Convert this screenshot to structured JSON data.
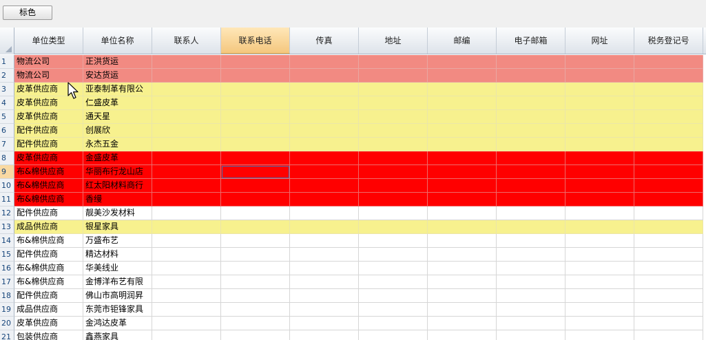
{
  "toolbar": {
    "button_label": "标色"
  },
  "columns": [
    "单位类型",
    "单位名称",
    "联系人",
    "联系电话",
    "传真",
    "地址",
    "邮编",
    "电子邮箱",
    "网址",
    "税务登记号"
  ],
  "selected_column": 3,
  "active_cell": {
    "row": 9,
    "col": 3
  },
  "colors": {
    "salmon": "#f28a82",
    "yellow": "#f7f18e",
    "red": "#ff0000",
    "white": "#ffffff"
  },
  "rows": [
    {
      "n": "1",
      "type": "物流公司",
      "name": "正洪货运",
      "color": "salmon"
    },
    {
      "n": "2",
      "type": "物流公司",
      "name": "安达货运",
      "color": "salmon"
    },
    {
      "n": "3",
      "type": "皮革供应商",
      "name": "亚泰制革有限公",
      "color": "yellow"
    },
    {
      "n": "4",
      "type": "皮革供应商",
      "name": "仁盛皮革",
      "color": "yellow"
    },
    {
      "n": "5",
      "type": "皮革供应商",
      "name": "通天星",
      "color": "yellow"
    },
    {
      "n": "6",
      "type": "配件供应商",
      "name": "创展欣",
      "color": "yellow"
    },
    {
      "n": "7",
      "type": "配件供应商",
      "name": "永杰五金",
      "color": "yellow"
    },
    {
      "n": "8",
      "type": "皮革供应商",
      "name": "金盛皮革",
      "color": "red"
    },
    {
      "n": "9",
      "type": "布&棉供应商",
      "name": "华丽布行龙山店",
      "color": "red"
    },
    {
      "n": "10",
      "type": "布&棉供应商",
      "name": "红太阳材料商行",
      "color": "red"
    },
    {
      "n": "11",
      "type": "布&棉供应商",
      "name": "香缦",
      "color": "red"
    },
    {
      "n": "12",
      "type": "配件供应商",
      "name": "靓美沙发材料",
      "color": "white"
    },
    {
      "n": "13",
      "type": "成品供应商",
      "name": "银星家具",
      "color": "yellow"
    },
    {
      "n": "14",
      "type": "布&棉供应商",
      "name": "万盛布艺",
      "color": "white"
    },
    {
      "n": "15",
      "type": "配件供应商",
      "name": "精达材料",
      "color": "white"
    },
    {
      "n": "16",
      "type": "布&棉供应商",
      "name": "华美线业",
      "color": "white"
    },
    {
      "n": "17",
      "type": "布&棉供应商",
      "name": "金博洋布艺有限",
      "color": "white"
    },
    {
      "n": "18",
      "type": "配件供应商",
      "name": "佛山市高明润昇",
      "color": "white"
    },
    {
      "n": "19",
      "type": "成品供应商",
      "name": "东莞市钜锋家具",
      "color": "white"
    },
    {
      "n": "20",
      "type": "皮革供应商",
      "name": "金鸿达皮革",
      "color": "white"
    },
    {
      "n": "21",
      "type": "包装供应商",
      "name": "鑫燕家具",
      "color": "white"
    }
  ]
}
